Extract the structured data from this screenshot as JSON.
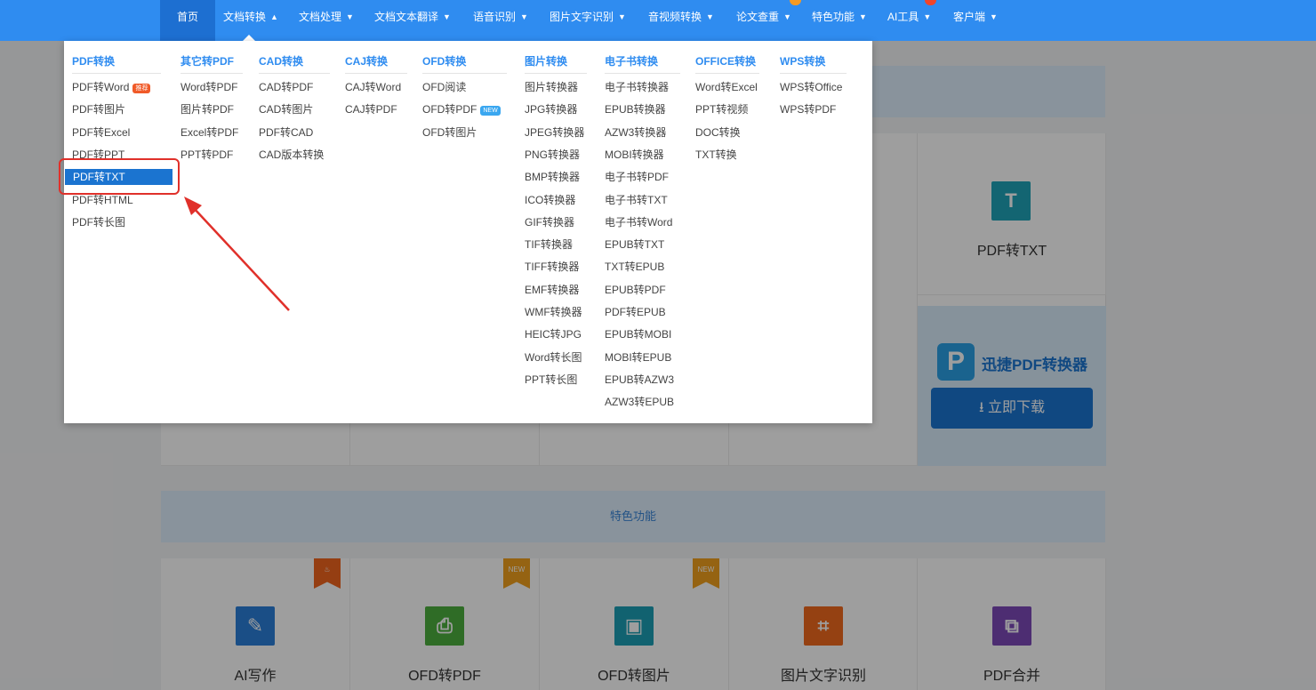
{
  "nav": {
    "items": [
      {
        "label": "首页"
      },
      {
        "label": "文档转换"
      },
      {
        "label": "文档处理"
      },
      {
        "label": "文档文本翻译"
      },
      {
        "label": "语音识别"
      },
      {
        "label": "图片文字识别"
      },
      {
        "label": "音视频转换"
      },
      {
        "label": "论文查重"
      },
      {
        "label": "特色功能"
      },
      {
        "label": "AI工具"
      },
      {
        "label": "客户端"
      }
    ]
  },
  "dropdown": {
    "columns": [
      {
        "title": "PDF转换",
        "items": [
          "PDF转Word",
          "PDF转图片",
          "PDF转Excel",
          "PDF转PPT",
          "PDF转TXT",
          "PDF转HTML",
          "PDF转长图"
        ],
        "hot_tag": "推荐",
        "selected": "PDF转TXT"
      },
      {
        "title": "其它转PDF",
        "items": [
          "Word转PDF",
          "图片转PDF",
          "Excel转PDF",
          "PPT转PDF"
        ]
      },
      {
        "title": "CAD转换",
        "items": [
          "CAD转PDF",
          "CAD转图片",
          "PDF转CAD",
          "CAD版本转换"
        ]
      },
      {
        "title": "CAJ转换",
        "items": [
          "CAJ转Word",
          "CAJ转PDF"
        ]
      },
      {
        "title": "OFD转换",
        "items": [
          "OFD阅读",
          "OFD转PDF",
          "OFD转图片"
        ],
        "new_tag": "NEW"
      },
      {
        "title": "图片转换",
        "items": [
          "图片转换器",
          "JPG转换器",
          "JPEG转换器",
          "PNG转换器",
          "BMP转换器",
          "ICO转换器",
          "GIF转换器",
          "TIF转换器",
          "TIFF转换器",
          "EMF转换器",
          "WMF转换器",
          "HEIC转JPG",
          "Word转长图",
          "PPT转长图"
        ]
      },
      {
        "title": "电子书转换",
        "items": [
          "电子书转换器",
          "EPUB转换器",
          "AZW3转换器",
          "MOBI转换器",
          "电子书转PDF",
          "电子书转TXT",
          "电子书转Word",
          "EPUB转TXT",
          "TXT转EPUB",
          "EPUB转PDF",
          "PDF转EPUB",
          "EPUB转MOBI",
          "MOBI转EPUB",
          "EPUB转AZW3",
          "AZW3转EPUB"
        ]
      },
      {
        "title": "OFFICE转换",
        "items": [
          "Word转Excel",
          "PPT转视频",
          "DOC转换",
          "TXT转换"
        ]
      },
      {
        "title": "WPS转换",
        "items": [
          "WPS转Office",
          "WPS转PDF"
        ]
      }
    ]
  },
  "page": {
    "pdf_to_txt_tile": {
      "label": "PDF转TXT",
      "icon": "T"
    },
    "promo": {
      "name": "迅捷PDF转换器",
      "download": "立即下载",
      "logo_letter": "P"
    },
    "feature_band": "特色功能",
    "feature_tiles": [
      {
        "label": "AI写作",
        "icon": "pencil-icon",
        "badge": "hot"
      },
      {
        "label": "OFD转PDF",
        "icon": "pdf-icon",
        "badge": "NEW"
      },
      {
        "label": "OFD转图片",
        "icon": "image-icon",
        "badge": "NEW"
      },
      {
        "label": "图片文字识别",
        "icon": "scan-icon"
      },
      {
        "label": "PDF合并",
        "icon": "merge-icon"
      }
    ]
  },
  "colors": {
    "nav_bg": "#2f8cf0",
    "accent": "#1b74d0",
    "highlight": "#e0302a"
  }
}
